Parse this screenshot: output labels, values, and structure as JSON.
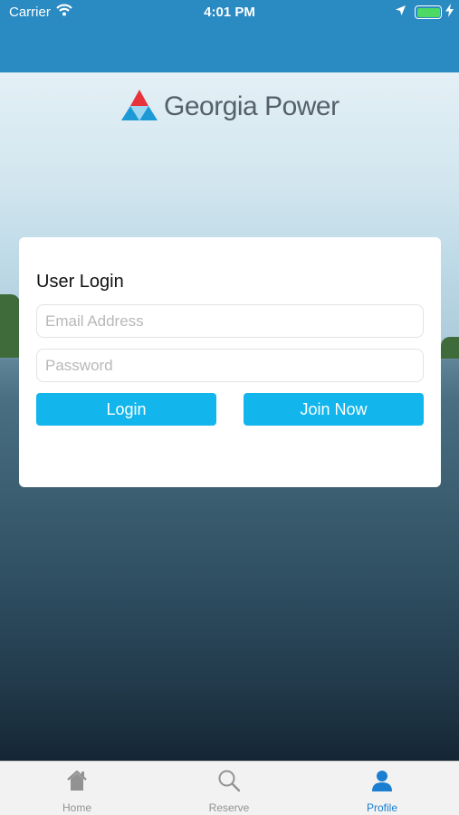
{
  "status_bar": {
    "carrier": "Carrier",
    "time": "4:01 PM",
    "battery_level": 1.0,
    "battery_color": "#4cd964"
  },
  "header": {
    "brand_name": "Georgia Power",
    "bar_color": "#2a8ac2"
  },
  "login": {
    "title": "User Login",
    "email_placeholder": "Email Address",
    "email_value": "",
    "password_placeholder": "Password",
    "password_value": "",
    "login_label": "Login",
    "join_label": "Join Now",
    "button_color": "#12b6ec"
  },
  "tab_bar": {
    "items": [
      {
        "label": "Home",
        "icon": "home-icon",
        "active": false
      },
      {
        "label": "Reserve",
        "icon": "search-icon",
        "active": false
      },
      {
        "label": "Profile",
        "icon": "profile-icon",
        "active": true
      }
    ],
    "active_color": "#1a7fd0",
    "inactive_color": "#929292"
  }
}
